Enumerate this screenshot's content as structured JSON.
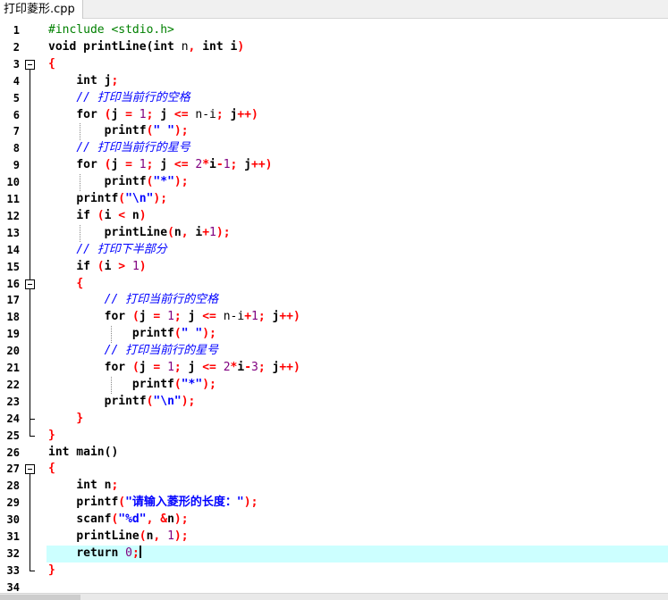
{
  "tab": {
    "title": "打印菱形.cpp"
  },
  "editor": {
    "current_line": 32,
    "lines": [
      [
        [
          "pp",
          "#include <stdio.h>"
        ]
      ],
      [
        [
          "kw",
          "void printLine("
        ],
        [
          "kw",
          "int"
        ],
        [
          "norm",
          " n"
        ],
        [
          "op",
          ","
        ],
        [
          "kw",
          " int i"
        ],
        [
          "op",
          ")"
        ]
      ],
      [
        [
          "op",
          "{"
        ]
      ],
      [
        [
          "norm",
          "    "
        ],
        [
          "kw",
          "int j"
        ],
        [
          "op",
          ";"
        ]
      ],
      [
        [
          "norm",
          "    "
        ],
        [
          "cm",
          "// 打印当前行的空格"
        ]
      ],
      [
        [
          "norm",
          "    "
        ],
        [
          "kw",
          "for "
        ],
        [
          "op",
          "("
        ],
        [
          "kw",
          "j "
        ],
        [
          "op",
          "="
        ],
        [
          "norm",
          " "
        ],
        [
          "num",
          "1"
        ],
        [
          "op",
          ";"
        ],
        [
          "kw",
          " j "
        ],
        [
          "op",
          "<="
        ],
        [
          "norm",
          " n-i"
        ],
        [
          "op",
          ";"
        ],
        [
          "kw",
          " j"
        ],
        [
          "op",
          "++)"
        ]
      ],
      [
        [
          "norm",
          "        "
        ],
        [
          "kw",
          "printf"
        ],
        [
          "op",
          "("
        ],
        [
          "str",
          "\" \""
        ],
        [
          "op",
          ");"
        ]
      ],
      [
        [
          "norm",
          "    "
        ],
        [
          "cm",
          "// 打印当前行的星号"
        ]
      ],
      [
        [
          "norm",
          "    "
        ],
        [
          "kw",
          "for "
        ],
        [
          "op",
          "("
        ],
        [
          "kw",
          "j "
        ],
        [
          "op",
          "="
        ],
        [
          "norm",
          " "
        ],
        [
          "num",
          "1"
        ],
        [
          "op",
          ";"
        ],
        [
          "kw",
          " j "
        ],
        [
          "op",
          "<="
        ],
        [
          "norm",
          " "
        ],
        [
          "num",
          "2"
        ],
        [
          "op",
          "*"
        ],
        [
          "kw",
          "i"
        ],
        [
          "op",
          "-"
        ],
        [
          "num",
          "1"
        ],
        [
          "op",
          ";"
        ],
        [
          "kw",
          " j"
        ],
        [
          "op",
          "++)"
        ]
      ],
      [
        [
          "norm",
          "        "
        ],
        [
          "kw",
          "printf"
        ],
        [
          "op",
          "("
        ],
        [
          "str",
          "\"*\""
        ],
        [
          "op",
          ");"
        ]
      ],
      [
        [
          "norm",
          "    "
        ],
        [
          "kw",
          "printf"
        ],
        [
          "op",
          "("
        ],
        [
          "str",
          "\"\\n\""
        ],
        [
          "op",
          ");"
        ]
      ],
      [
        [
          "norm",
          "    "
        ],
        [
          "kw",
          "if "
        ],
        [
          "op",
          "("
        ],
        [
          "kw",
          "i "
        ],
        [
          "op",
          "<"
        ],
        [
          "kw",
          " n"
        ],
        [
          "op",
          ")"
        ]
      ],
      [
        [
          "norm",
          "        "
        ],
        [
          "kw",
          "printLine"
        ],
        [
          "op",
          "("
        ],
        [
          "kw",
          "n"
        ],
        [
          "op",
          ","
        ],
        [
          "kw",
          " i"
        ],
        [
          "op",
          "+"
        ],
        [
          "num",
          "1"
        ],
        [
          "op",
          ");"
        ]
      ],
      [
        [
          "norm",
          "    "
        ],
        [
          "cm",
          "// 打印下半部分"
        ]
      ],
      [
        [
          "norm",
          "    "
        ],
        [
          "kw",
          "if "
        ],
        [
          "op",
          "("
        ],
        [
          "kw",
          "i "
        ],
        [
          "op",
          ">"
        ],
        [
          "norm",
          " "
        ],
        [
          "num",
          "1"
        ],
        [
          "op",
          ")"
        ]
      ],
      [
        [
          "norm",
          "    "
        ],
        [
          "op",
          "{"
        ]
      ],
      [
        [
          "norm",
          "        "
        ],
        [
          "cm",
          "// 打印当前行的空格"
        ]
      ],
      [
        [
          "norm",
          "        "
        ],
        [
          "kw",
          "for "
        ],
        [
          "op",
          "("
        ],
        [
          "kw",
          "j "
        ],
        [
          "op",
          "="
        ],
        [
          "norm",
          " "
        ],
        [
          "num",
          "1"
        ],
        [
          "op",
          ";"
        ],
        [
          "kw",
          " j "
        ],
        [
          "op",
          "<="
        ],
        [
          "norm",
          " n-i"
        ],
        [
          "op",
          "+"
        ],
        [
          "num",
          "1"
        ],
        [
          "op",
          ";"
        ],
        [
          "kw",
          " j"
        ],
        [
          "op",
          "++)"
        ]
      ],
      [
        [
          "norm",
          "            "
        ],
        [
          "kw",
          "printf"
        ],
        [
          "op",
          "("
        ],
        [
          "str",
          "\" \""
        ],
        [
          "op",
          ");"
        ]
      ],
      [
        [
          "norm",
          "        "
        ],
        [
          "cm",
          "// 打印当前行的星号"
        ]
      ],
      [
        [
          "norm",
          "        "
        ],
        [
          "kw",
          "for "
        ],
        [
          "op",
          "("
        ],
        [
          "kw",
          "j "
        ],
        [
          "op",
          "="
        ],
        [
          "norm",
          " "
        ],
        [
          "num",
          "1"
        ],
        [
          "op",
          ";"
        ],
        [
          "kw",
          " j "
        ],
        [
          "op",
          "<="
        ],
        [
          "norm",
          " "
        ],
        [
          "num",
          "2"
        ],
        [
          "op",
          "*"
        ],
        [
          "kw",
          "i"
        ],
        [
          "op",
          "-"
        ],
        [
          "num",
          "3"
        ],
        [
          "op",
          ";"
        ],
        [
          "kw",
          " j"
        ],
        [
          "op",
          "++)"
        ]
      ],
      [
        [
          "norm",
          "            "
        ],
        [
          "kw",
          "printf"
        ],
        [
          "op",
          "("
        ],
        [
          "str",
          "\"*\""
        ],
        [
          "op",
          ");"
        ]
      ],
      [
        [
          "norm",
          "        "
        ],
        [
          "kw",
          "printf"
        ],
        [
          "op",
          "("
        ],
        [
          "str",
          "\"\\n\""
        ],
        [
          "op",
          ");"
        ]
      ],
      [
        [
          "norm",
          "    "
        ],
        [
          "op",
          "}"
        ]
      ],
      [
        [
          "op",
          "}"
        ]
      ],
      [
        [
          "kw",
          "int main()"
        ]
      ],
      [
        [
          "op",
          "{"
        ]
      ],
      [
        [
          "norm",
          "    "
        ],
        [
          "kw",
          "int n"
        ],
        [
          "op",
          ";"
        ]
      ],
      [
        [
          "norm",
          "    "
        ],
        [
          "kw",
          "printf"
        ],
        [
          "op",
          "("
        ],
        [
          "str",
          "\"请输入菱形的长度：\""
        ],
        [
          "op",
          ");"
        ]
      ],
      [
        [
          "norm",
          "    "
        ],
        [
          "kw",
          "scanf"
        ],
        [
          "op",
          "("
        ],
        [
          "str",
          "\"%d\""
        ],
        [
          "op",
          ","
        ],
        [
          "norm",
          " "
        ],
        [
          "op",
          "&"
        ],
        [
          "kw",
          "n"
        ],
        [
          "op",
          ");"
        ]
      ],
      [
        [
          "norm",
          "    "
        ],
        [
          "kw",
          "printLine"
        ],
        [
          "op",
          "("
        ],
        [
          "kw",
          "n"
        ],
        [
          "op",
          ","
        ],
        [
          "norm",
          " "
        ],
        [
          "num",
          "1"
        ],
        [
          "op",
          ");"
        ]
      ],
      [
        [
          "norm",
          "    "
        ],
        [
          "kw",
          "return "
        ],
        [
          "num",
          "0"
        ],
        [
          "op",
          ";"
        ]
      ],
      [
        [
          "op",
          "}"
        ]
      ],
      []
    ]
  }
}
